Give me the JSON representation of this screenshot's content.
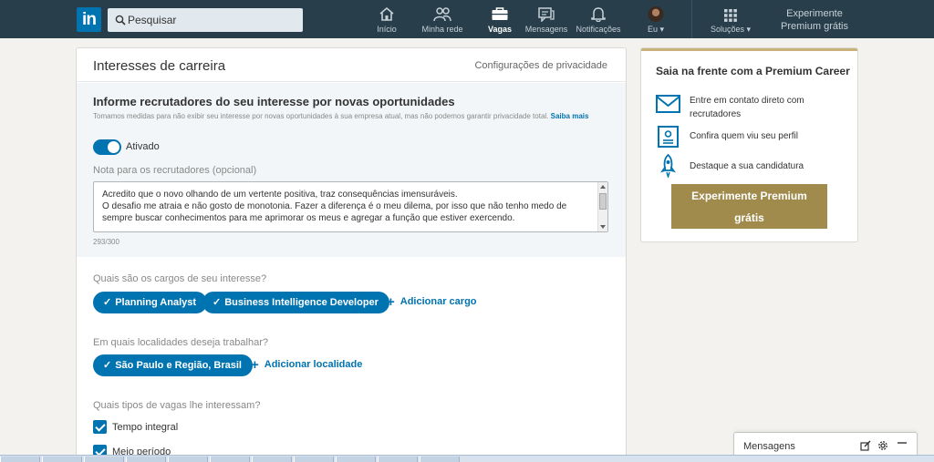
{
  "nav": {
    "logo": "in",
    "search_placeholder": "Pesquisar",
    "items": [
      {
        "label": "Início"
      },
      {
        "label": "Minha rede"
      },
      {
        "label": "Vagas"
      },
      {
        "label": "Mensagens"
      },
      {
        "label": "Notificações"
      },
      {
        "label": "Eu"
      }
    ],
    "solucoes": "Soluções",
    "premium_line1": "Experimente",
    "premium_line2": "Premium grátis"
  },
  "main": {
    "title": "Interesses de carreira",
    "privacy_link": "Configurações de privacidade",
    "inform_title": "Informe recrutadores do seu interesse por novas oportunidades",
    "inform_sub": "Tomamos medidas para não exibir seu interesse por novas oportunidades à sua empresa atual, mas não podemos garantir privacidade total.",
    "saiba_mais": "Saiba mais",
    "toggle_label": "Ativado",
    "note_label": "Nota para os recrutadores (opcional)",
    "note_text": "Acredito que  o novo olhando de um vertente positiva, traz consequências imensuráveis.\nO desafio me atraia e não gosto de monotonia. Fazer a diferença é o meu dilema, por isso que não tenho medo de sempre buscar conhecimentos para me aprimorar os meus e agregar a função que estiver exercendo.",
    "note_counter": "293/300",
    "q_cargos": "Quais são os cargos de seu interesse?",
    "cargos": [
      "Planning Analyst",
      "Business Intelligence Developer"
    ],
    "add_cargo": "Adicionar cargo",
    "q_local": "Em quais localidades deseja trabalhar?",
    "locais": [
      "São Paulo e Região, Brasil"
    ],
    "add_local": "Adicionar localidade",
    "q_tipos": "Quais tipos de vagas lhe interessam?",
    "tipos": [
      "Tempo integral",
      "Meio período"
    ]
  },
  "side": {
    "title": "Saia na frente com a Premium Career",
    "features": [
      {
        "line1": "Entre em contato direto com",
        "line2": "recrutadores"
      },
      {
        "line1": "Confira quem viu seu perfil",
        "line2": ""
      },
      {
        "line1": "Destaque a sua candidatura",
        "line2": ""
      }
    ],
    "button_line1": "Experimente Premium",
    "button_line2": "grátis"
  },
  "messaging": {
    "label": "Mensagens"
  },
  "colors": {
    "nav_bg": "#283e4a",
    "brand_blue": "#0073b1",
    "premium_gold": "#a08b4d"
  }
}
